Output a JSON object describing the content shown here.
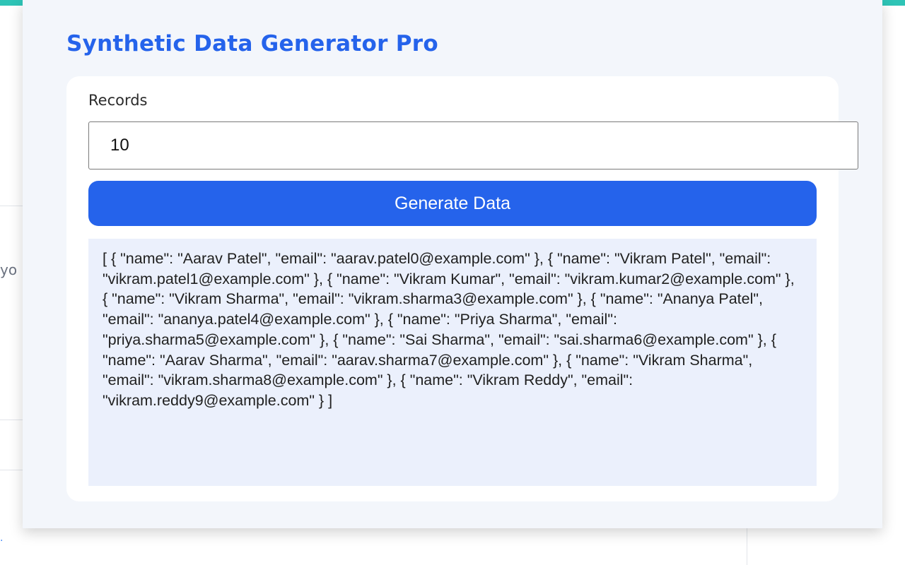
{
  "background": {
    "fragment_text": "yo"
  },
  "app": {
    "title": "Synthetic Data Generator Pro",
    "accent_color": "#2563eb"
  },
  "form": {
    "records_label": "Records",
    "records_value": "10",
    "generate_button_label": "Generate Data"
  },
  "output": {
    "text": "[ { \"name\": \"Aarav Patel\", \"email\": \"aarav.patel0@example.com\" }, { \"name\": \"Vikram Patel\", \"email\": \"vikram.patel1@example.com\" }, { \"name\": \"Vikram Kumar\", \"email\": \"vikram.kumar2@example.com\" }, { \"name\": \"Vikram Sharma\", \"email\": \"vikram.sharma3@example.com\" }, { \"name\": \"Ananya Patel\", \"email\": \"ananya.patel4@example.com\" }, { \"name\": \"Priya Sharma\", \"email\": \"priya.sharma5@example.com\" }, { \"name\": \"Sai Sharma\", \"email\": \"sai.sharma6@example.com\" }, { \"name\": \"Aarav Sharma\", \"email\": \"aarav.sharma7@example.com\" }, { \"name\": \"Vikram Sharma\", \"email\": \"vikram.sharma8@example.com\" }, { \"name\": \"Vikram Reddy\", \"email\": \"vikram.reddy9@example.com\" } ]",
    "records": [
      {
        "name": "Aarav Patel",
        "email": "aarav.patel0@example.com"
      },
      {
        "name": "Vikram Patel",
        "email": "vikram.patel1@example.com"
      },
      {
        "name": "Vikram Kumar",
        "email": "vikram.kumar2@example.com"
      },
      {
        "name": "Vikram Sharma",
        "email": "vikram.sharma3@example.com"
      },
      {
        "name": "Ananya Patel",
        "email": "ananya.patel4@example.com"
      },
      {
        "name": "Priya Sharma",
        "email": "priya.sharma5@example.com"
      },
      {
        "name": "Sai Sharma",
        "email": "sai.sharma6@example.com"
      },
      {
        "name": "Aarav Sharma",
        "email": "aarav.sharma7@example.com"
      },
      {
        "name": "Vikram Sharma",
        "email": "vikram.sharma8@example.com"
      },
      {
        "name": "Vikram Reddy",
        "email": "vikram.reddy9@example.com"
      }
    ]
  }
}
